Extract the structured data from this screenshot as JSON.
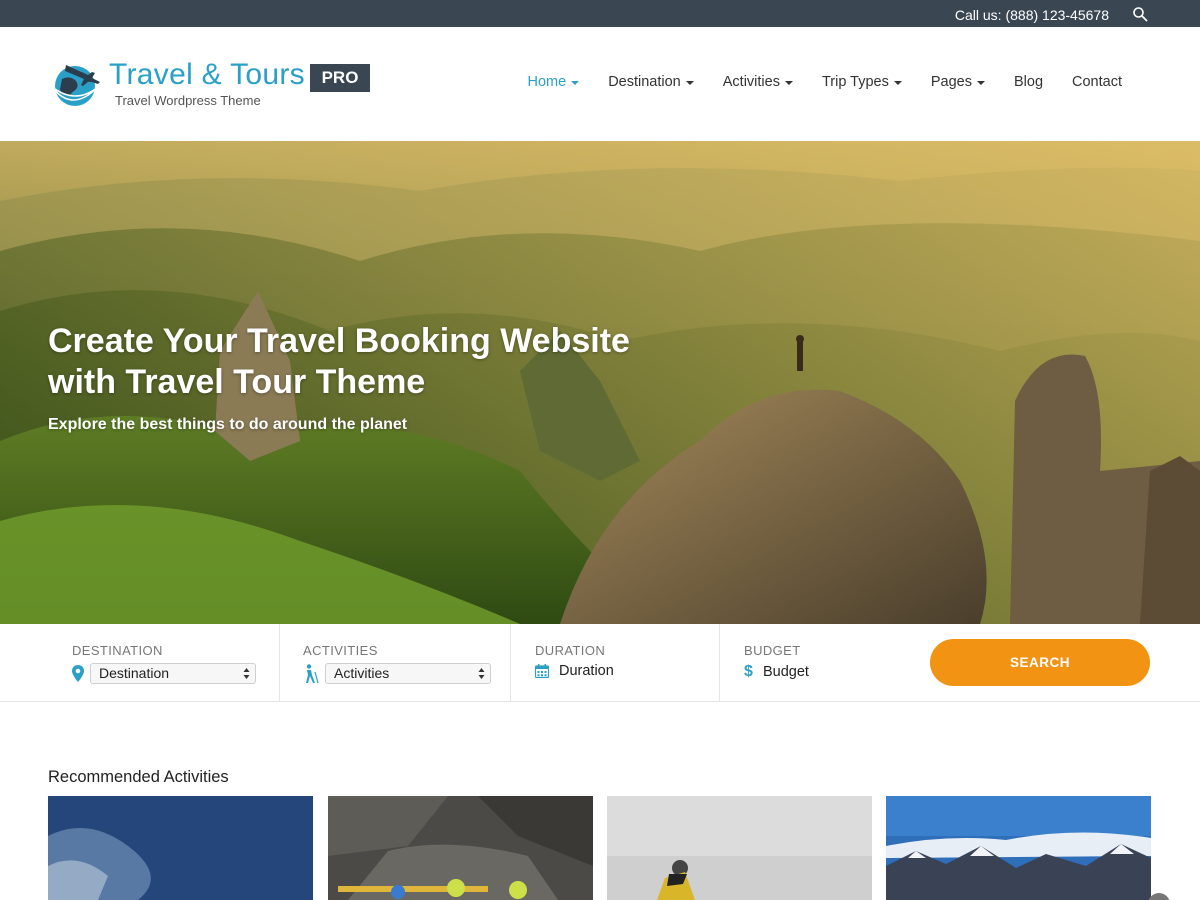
{
  "topbar": {
    "call_text": "Call us: (888) 123-45678",
    "search_icon": "search-icon"
  },
  "header": {
    "logo_title": "Travel & Tours",
    "logo_badge": "PRO",
    "logo_subtitle": "Travel Wordpress Theme",
    "nav": [
      {
        "label": "Home",
        "dropdown": true,
        "active": true
      },
      {
        "label": "Destination",
        "dropdown": true
      },
      {
        "label": "Activities",
        "dropdown": true
      },
      {
        "label": "Trip Types",
        "dropdown": true
      },
      {
        "label": "Pages",
        "dropdown": true
      },
      {
        "label": "Blog",
        "dropdown": false
      },
      {
        "label": "Contact",
        "dropdown": false
      }
    ]
  },
  "hero": {
    "title_line1": "Create Your Travel Booking Website",
    "title_line2": "with Travel Tour Theme",
    "subtitle": "Explore the best things to do around the planet"
  },
  "search": {
    "destination": {
      "label": "DESTINATION",
      "value": "Destination",
      "icon": "map-pin-icon"
    },
    "activities": {
      "label": "ACTIVITIES",
      "value": "Activities",
      "icon": "hiker-icon"
    },
    "duration": {
      "label": "DURATION",
      "value": "Duration",
      "icon": "calendar-icon"
    },
    "budget": {
      "label": "BUDGET",
      "value": "Budget",
      "icon": "dollar-icon"
    },
    "button_label": "SEARCH"
  },
  "recommended": {
    "title": "Recommended Activities"
  },
  "colors": {
    "accent": "#2aa0c8",
    "topbar": "#3a4651",
    "button": "#f39314"
  }
}
